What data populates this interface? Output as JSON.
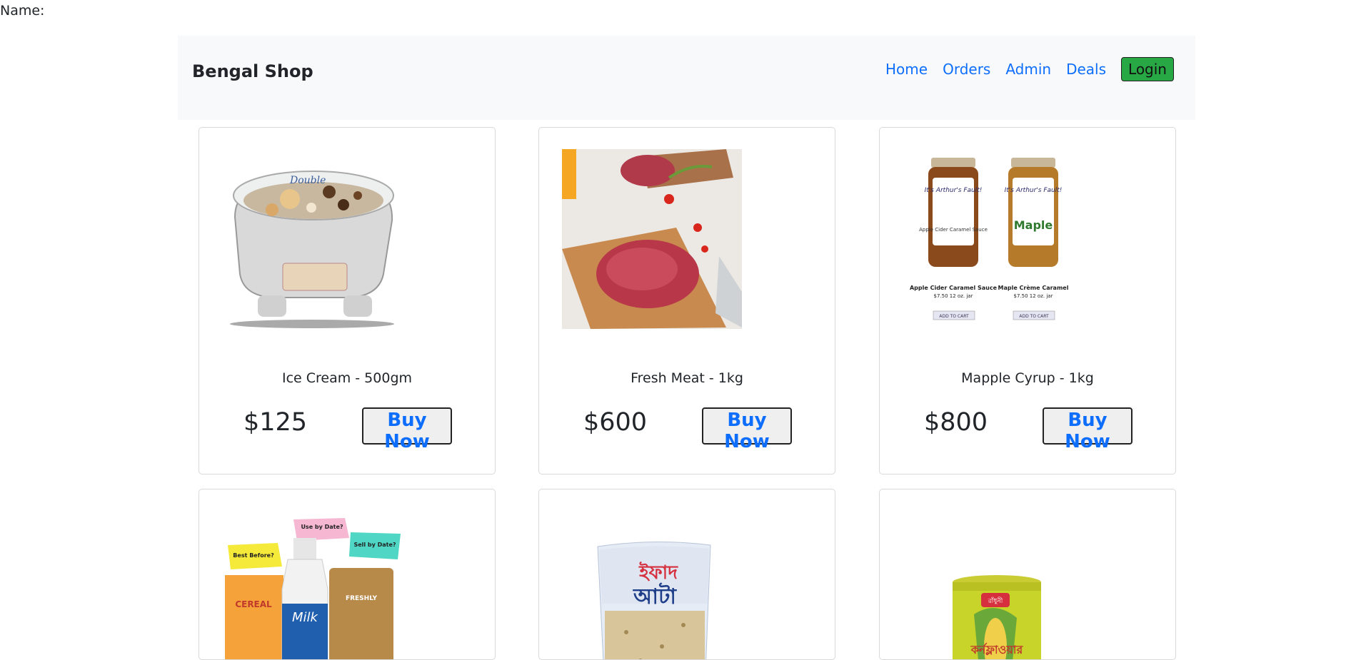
{
  "name_label": "Name:",
  "navbar": {
    "brand": "Bengal Shop",
    "links": [
      "Home",
      "Orders",
      "Admin",
      "Deals"
    ],
    "login": "Login"
  },
  "products": [
    {
      "title": "Ice Cream - 500gm",
      "price": "$125",
      "button": "Buy Now",
      "image": "ice-cream-tub-image"
    },
    {
      "title": "Fresh Meat - 1kg",
      "price": "$600",
      "button": "Buy Now",
      "image": "meat-on-cutting-board-image"
    },
    {
      "title": "Mapple Cyrup - 1kg",
      "price": "$800",
      "button": "Buy Now",
      "image": "syrup-jars-image",
      "image_text": {
        "jar1_label": "It's Arthur's Fault!",
        "jar1_sub": "Apple Cider Caramel Sauce",
        "jar2_label": "It's Arthur's Fault!",
        "jar2_sub": "Maple",
        "caption1": "Apple Cider Caramel Sauce",
        "caption1_price": "$7.50 12 oz. jar",
        "caption2": "Maple Crème Caramel",
        "caption2_price": "$7.50 12 oz. jar",
        "cart": "ADD TO CART"
      }
    },
    {
      "image": "dairy-products-image",
      "image_text": {
        "tag1": "Best Before?",
        "tag2": "Use by Date?",
        "tag3": "Sell by Date?",
        "box": "CEREAL",
        "bottle": "Milk",
        "bag": "FRESHLY"
      }
    },
    {
      "image": "atta-flour-bag-image",
      "image_text": {
        "brand": "ইফাদ",
        "product": "আটা"
      }
    },
    {
      "image": "cornflour-can-image",
      "image_text": {
        "brand": "রাঁধুনী",
        "product": "কর্নফ্লাওয়ার"
      }
    }
  ]
}
